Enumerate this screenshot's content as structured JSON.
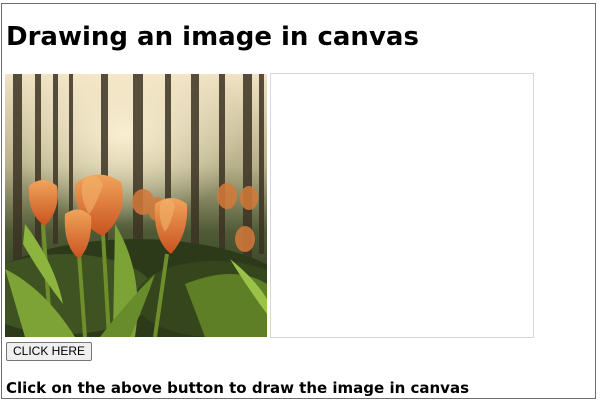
{
  "page": {
    "heading": "Drawing an image in canvas",
    "button_label": "CLICK HERE",
    "instruction": "Click on the above button to draw the image in canvas"
  },
  "image": {
    "subject": "orange-tulips-in-forest"
  }
}
